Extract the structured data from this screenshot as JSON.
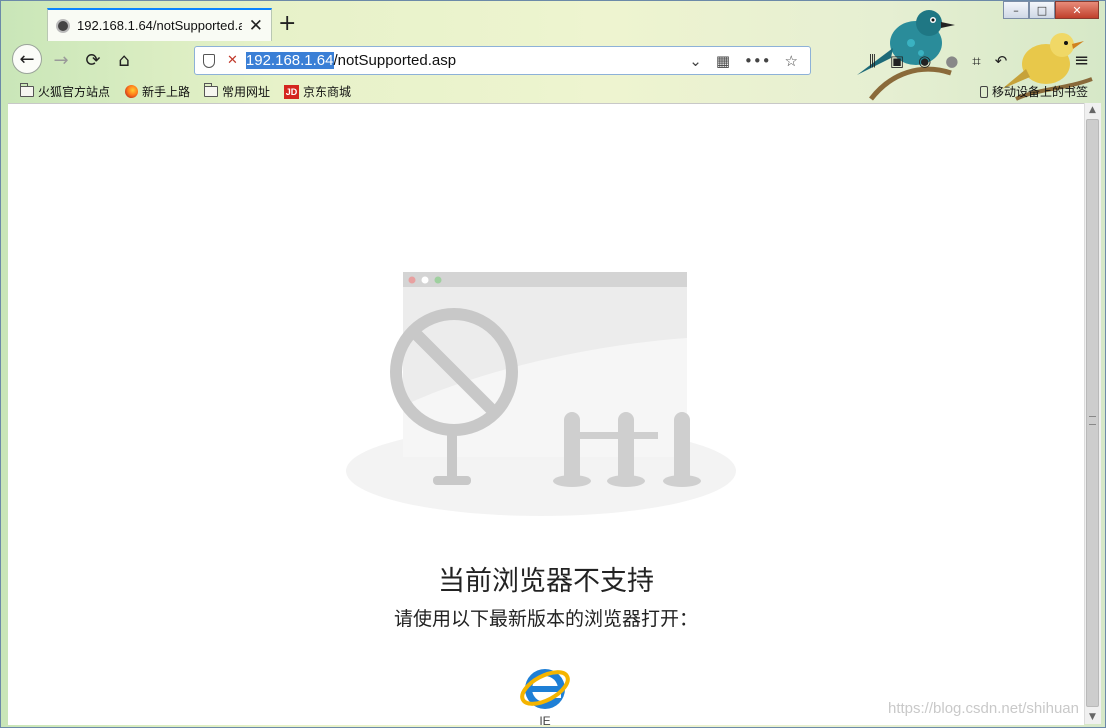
{
  "window": {
    "minimize_glyph": "–",
    "maximize_glyph": "□",
    "close_glyph": "✕"
  },
  "tab": {
    "title": "192.168.1.64/notSupported.a",
    "close_glyph": "✕",
    "new_tab_glyph": "+"
  },
  "nav": {
    "back_glyph": "←",
    "forward_glyph": "→",
    "reload_glyph": "⟳",
    "home_glyph": "⌂"
  },
  "urlbar": {
    "host": "192.168.1.64",
    "path": "/notSupported.asp",
    "insecure_glyph": "✕",
    "dropdown_glyph": "⌄",
    "qr_glyph": "▦",
    "more_glyph": "•••",
    "star_glyph": "☆"
  },
  "toolbar": {
    "library_glyph": "⫼",
    "sidebar_glyph": "▣",
    "account_glyph": "◉",
    "chat_glyph": "●",
    "screenshot_glyph": "⌗",
    "undo_glyph": "↶",
    "menu_glyph": "≡"
  },
  "bookmarks": [
    {
      "label": "火狐官方站点",
      "icon": "folder-icon"
    },
    {
      "label": "新手上路",
      "icon": "firefox-icon"
    },
    {
      "label": "常用网址",
      "icon": "folder-icon"
    },
    {
      "label": "京东商城",
      "icon": "jd-icon",
      "icon_text": "JD"
    }
  ],
  "mobile_bookmarks": "移动设备上的书签",
  "page": {
    "heading": "当前浏览器不支持",
    "subheading": "请使用以下最新版本的浏览器打开：",
    "browser_label": "IE"
  },
  "watermark": "https://blog.csdn.net/shihuan",
  "colors": {
    "accent": "#0a84ff",
    "url_highlight": "#3a7fd6",
    "illustration_gray": "#c8c8c8",
    "ie_blue": "#1e7fd6",
    "ie_ring": "#f4b400"
  }
}
